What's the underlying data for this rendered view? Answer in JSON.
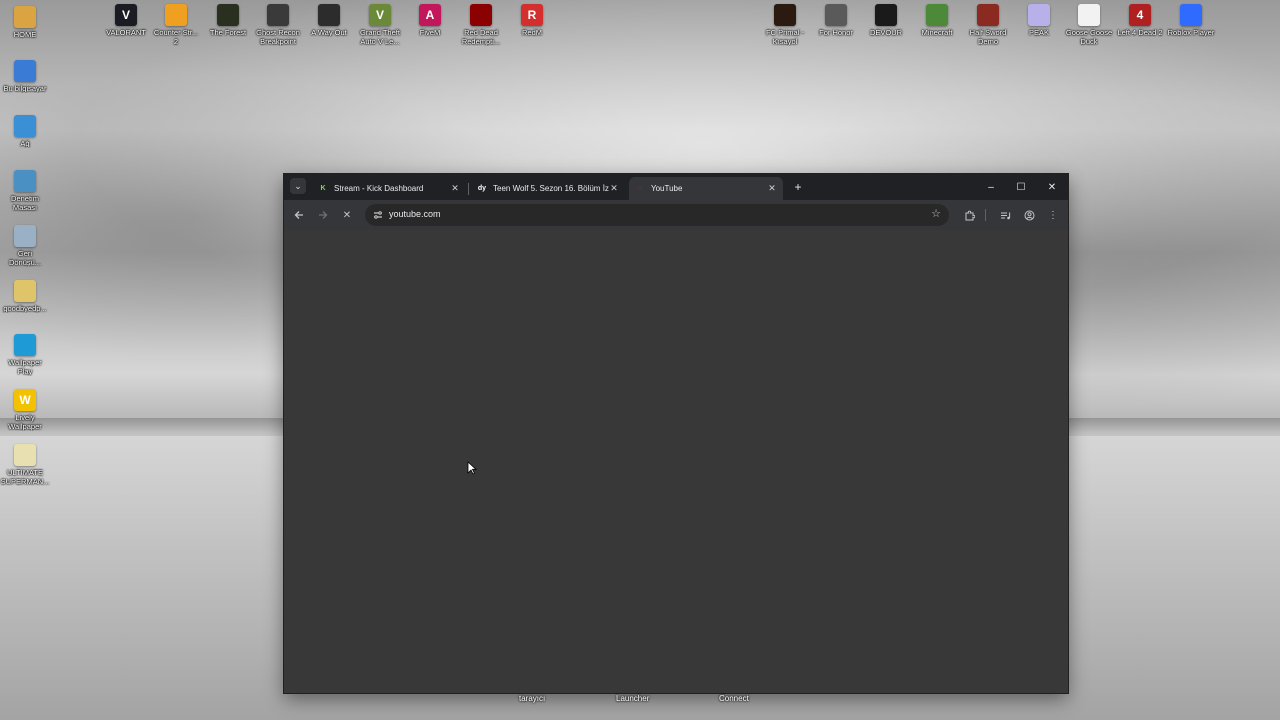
{
  "desktop": {
    "left_icons": [
      {
        "label": "HOME",
        "icon": "folder-icon",
        "color": "#d9a441",
        "glyph": ""
      },
      {
        "label": "Bu bilgisayar",
        "icon": "computer-icon",
        "color": "#3a7bd5",
        "glyph": ""
      },
      {
        "label": "Ağ",
        "icon": "network-icon",
        "color": "#3a8fd5",
        "glyph": ""
      },
      {
        "label": "Denetim\nMasası",
        "icon": "control-panel-icon",
        "color": "#4a90c2",
        "glyph": ""
      },
      {
        "label": "Geri\nDönüşü...",
        "icon": "recycle-bin-icon",
        "color": "#9ab0c4",
        "glyph": ""
      },
      {
        "label": "goodbyedp...",
        "icon": "folder-icon",
        "color": "#e0c46a",
        "glyph": ""
      },
      {
        "label": "Wallpaper\nPlay",
        "icon": "wallpaper-play-icon",
        "color": "#1e9ad6",
        "glyph": ""
      },
      {
        "label": "Lively\nWallpaper",
        "icon": "lively-wallpaper-icon",
        "color": "#f2c200",
        "glyph": "W"
      },
      {
        "label": "ULTIMATE\nSUPERMAN...",
        "icon": "file-icon",
        "color": "#e8e0b0",
        "glyph": ""
      }
    ],
    "top_icons": [
      {
        "label": "VALORANT",
        "icon": "valorant-icon",
        "color": "#1b1b24",
        "glyph": "V"
      },
      {
        "label": "Counter Str...\n2",
        "icon": "counter-strike-icon",
        "color": "#f0a020",
        "glyph": ""
      },
      {
        "label": "The Forest",
        "icon": "the-forest-icon",
        "color": "#2a3020",
        "glyph": ""
      },
      {
        "label": "Ghost Recon\nBreakpoint",
        "icon": "ghost-recon-icon",
        "color": "#3a3a3a",
        "glyph": ""
      },
      {
        "label": "A Way Out",
        "icon": "a-way-out-icon",
        "color": "#2c2c2c",
        "glyph": ""
      },
      {
        "label": "Grand Theft\nAuto V Le...",
        "icon": "gta-v-icon",
        "color": "#6a8a3a",
        "glyph": "V"
      },
      {
        "label": "FiveM",
        "icon": "fivem-icon",
        "color": "#c2185b",
        "glyph": "A"
      },
      {
        "label": "Red Dead\nRedempti...",
        "icon": "red-dead-icon",
        "color": "#8b0000",
        "glyph": ""
      },
      {
        "label": "RedM",
        "icon": "redm-icon",
        "color": "#d32f2f",
        "glyph": "R"
      },
      {
        "label": "FC Primal -\nKısayol",
        "icon": "far-cry-primal-icon",
        "color": "#2a1a10",
        "glyph": ""
      },
      {
        "label": "For Honor",
        "icon": "for-honor-icon",
        "color": "#5a5a5a",
        "glyph": ""
      },
      {
        "label": "DEVOUR",
        "icon": "devour-icon",
        "color": "#1a1a1a",
        "glyph": ""
      },
      {
        "label": "Minecraft",
        "icon": "minecraft-icon",
        "color": "#4c8a3a",
        "glyph": ""
      },
      {
        "label": "Half Sword\nDemo",
        "icon": "half-sword-icon",
        "color": "#8a2a20",
        "glyph": ""
      },
      {
        "label": "PEAK",
        "icon": "peak-icon",
        "color": "#b8b0e8",
        "glyph": ""
      },
      {
        "label": "Goose Goose\nDuck",
        "icon": "goose-goose-duck-icon",
        "color": "#f2f2f2",
        "glyph": ""
      },
      {
        "label": "Left 4 Dead 2",
        "icon": "left-4-dead-icon",
        "color": "#b02020",
        "glyph": "4"
      },
      {
        "label": "Roblox Player",
        "icon": "roblox-icon",
        "color": "#2f6bff",
        "glyph": ""
      }
    ],
    "taskbar_labels": [
      "tarayıcı",
      "Launcher",
      "Connect"
    ]
  },
  "browser": {
    "tabs": [
      {
        "title": "Stream - Kick Dashboard",
        "favicon": "kick-icon",
        "favicon_glyph": "K",
        "favicon_color": "#53fc18",
        "active": false
      },
      {
        "title": "Teen Wolf 5. Sezon 16. Bölüm İzle",
        "favicon": "dizi-icon",
        "favicon_glyph": "dy",
        "favicon_color": "#ffffff",
        "active": false
      },
      {
        "title": "YouTube",
        "favicon": "loading-spinner-icon",
        "favicon_glyph": "◌",
        "favicon_color": "#e91e63",
        "active": true
      }
    ],
    "new_tab_label": "+",
    "url": "youtube.com",
    "window_controls": [
      "–",
      "☐",
      "✕"
    ]
  }
}
